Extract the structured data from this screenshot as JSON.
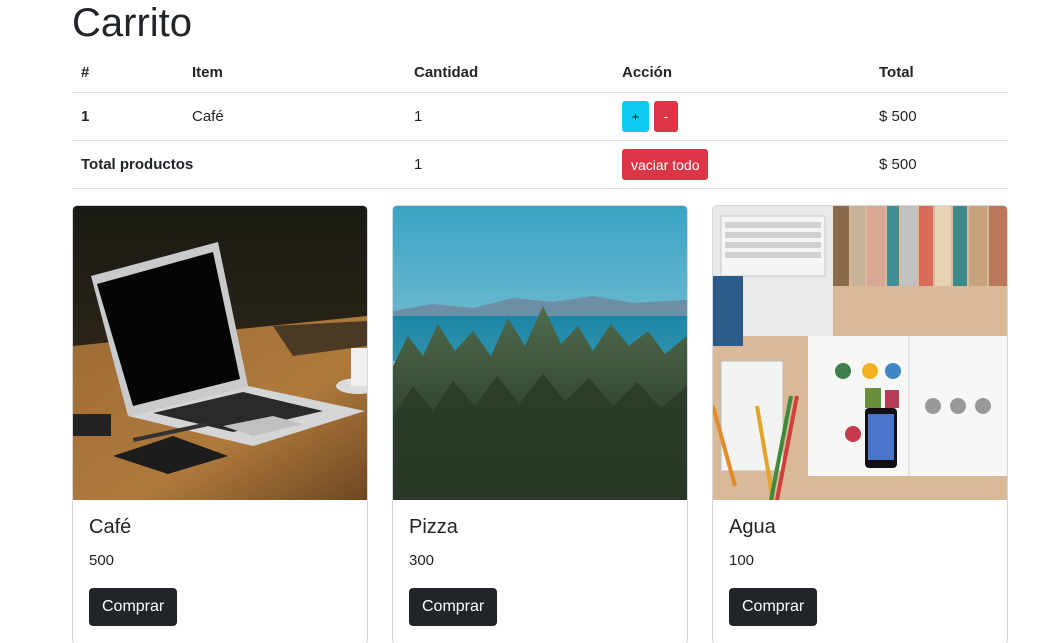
{
  "page": {
    "title": "Carrito"
  },
  "cart": {
    "headers": [
      "#",
      "Item",
      "Cantidad",
      "Acción",
      "Total"
    ],
    "items": [
      {
        "index": "1",
        "name": "Café",
        "quantity": "1",
        "plus_label": "+",
        "minus_label": "-",
        "total": "$ 500"
      }
    ],
    "summary": {
      "label": "Total productos",
      "quantity": "1",
      "empty_label": "vaciar todo",
      "total": "$ 500"
    }
  },
  "products": [
    {
      "title": "Café",
      "price": "500",
      "buy_label": "Comprar",
      "image": "laptop on wooden desk"
    },
    {
      "title": "Pizza",
      "price": "300",
      "buy_label": "Comprar",
      "image": "forest and sea landscape"
    },
    {
      "title": "Agua",
      "price": "100",
      "buy_label": "Comprar",
      "image": "desk with books, notebook and phone"
    }
  ],
  "colors": {
    "info": "#0dcaf0",
    "danger": "#dc3545",
    "dark": "#212529",
    "border": "#dee2e6"
  }
}
